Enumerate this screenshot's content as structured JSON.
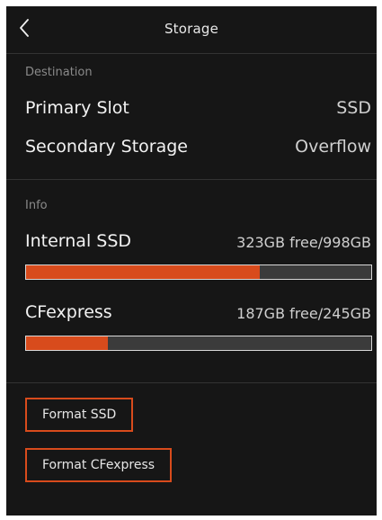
{
  "header": {
    "title": "Storage",
    "back_icon": "chevron-left-icon"
  },
  "destination": {
    "label": "Destination",
    "rows": [
      {
        "label": "Primary Slot",
        "value": "SSD"
      },
      {
        "label": "Secondary Storage",
        "value": "Overflow"
      }
    ]
  },
  "info": {
    "label": "Info",
    "drives": [
      {
        "name": "Internal SSD",
        "summary": "323GB free/998GB",
        "used_fraction": 0.676
      },
      {
        "name": "CFexpress",
        "summary": "187GB free/245GB",
        "used_fraction": 0.237
      }
    ]
  },
  "actions": {
    "format_ssd": "Format SSD",
    "format_cfexpress": "Format CFexpress"
  },
  "colors": {
    "accent": "#d84b1c",
    "background": "#161616",
    "bar_track": "#3b3b3b"
  }
}
